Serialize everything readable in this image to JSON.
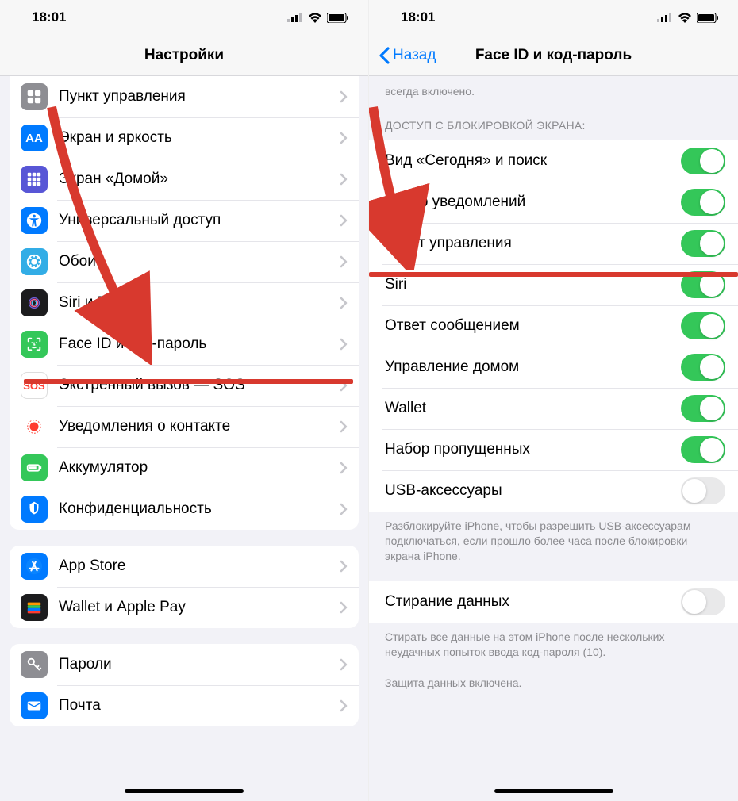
{
  "statusbar": {
    "time": "18:01"
  },
  "left": {
    "title": "Настройки",
    "items": [
      {
        "label": "Пункт управления",
        "icon": "control-center",
        "bg": "bg-gray"
      },
      {
        "label": "Экран и яркость",
        "icon": "display",
        "bg": "bg-blue"
      },
      {
        "label": "Экран «Домой»",
        "icon": "home-screen",
        "bg": "bg-indigo"
      },
      {
        "label": "Универсальный доступ",
        "icon": "accessibility",
        "bg": "bg-blue"
      },
      {
        "label": "Обои",
        "icon": "wallpaper",
        "bg": "bg-cyan"
      },
      {
        "label": "Siri и Поиск",
        "icon": "siri",
        "bg": "bg-dark"
      },
      {
        "label": "Face ID и код-пароль",
        "icon": "faceid",
        "bg": "bg-green"
      },
      {
        "label": "Экстренный вызов — SOS",
        "icon": "sos",
        "bg": "bg-white"
      },
      {
        "label": "Уведомления о контакте",
        "icon": "exposure",
        "bg": "bg-orange"
      },
      {
        "label": "Аккумулятор",
        "icon": "battery",
        "bg": "bg-green"
      },
      {
        "label": "Конфиденциальность",
        "icon": "privacy",
        "bg": "bg-blue"
      }
    ],
    "group2": [
      {
        "label": "App Store",
        "icon": "appstore",
        "bg": "bg-blue"
      },
      {
        "label": "Wallet и Apple Pay",
        "icon": "wallet",
        "bg": "bg-dark"
      }
    ],
    "group3": [
      {
        "label": "Пароли",
        "icon": "key",
        "bg": "bg-gray"
      },
      {
        "label": "Почта",
        "icon": "mail",
        "bg": "bg-blue"
      }
    ]
  },
  "right": {
    "back": "Назад",
    "title": "Face ID и код-пароль",
    "topcaption": "всегда включено.",
    "header": "ДОСТУП С БЛОКИРОВКОЙ ЭКРАНА:",
    "toggles": [
      {
        "label": "Вид «Сегодня» и поиск",
        "on": true
      },
      {
        "label": "Центр уведомлений",
        "on": true
      },
      {
        "label": "Пункт управления",
        "on": true
      },
      {
        "label": "Siri",
        "on": true
      },
      {
        "label": "Ответ сообщением",
        "on": true
      },
      {
        "label": "Управление домом",
        "on": true
      },
      {
        "label": "Wallet",
        "on": true
      },
      {
        "label": "Набор пропущенных",
        "on": true
      },
      {
        "label": "USB-аксессуары",
        "on": false
      }
    ],
    "usbcaption": "Разблокируйте iPhone, чтобы разрешить USB-аксессуарам подключаться, если прошло более часа после блокировки экрана iPhone.",
    "erase": {
      "label": "Стирание данных",
      "on": false
    },
    "erasecaption": "Стирать все данные на этом iPhone после нескольких неудачных попыток ввода код-пароля (10).",
    "protcaption": "Защита данных включена."
  }
}
